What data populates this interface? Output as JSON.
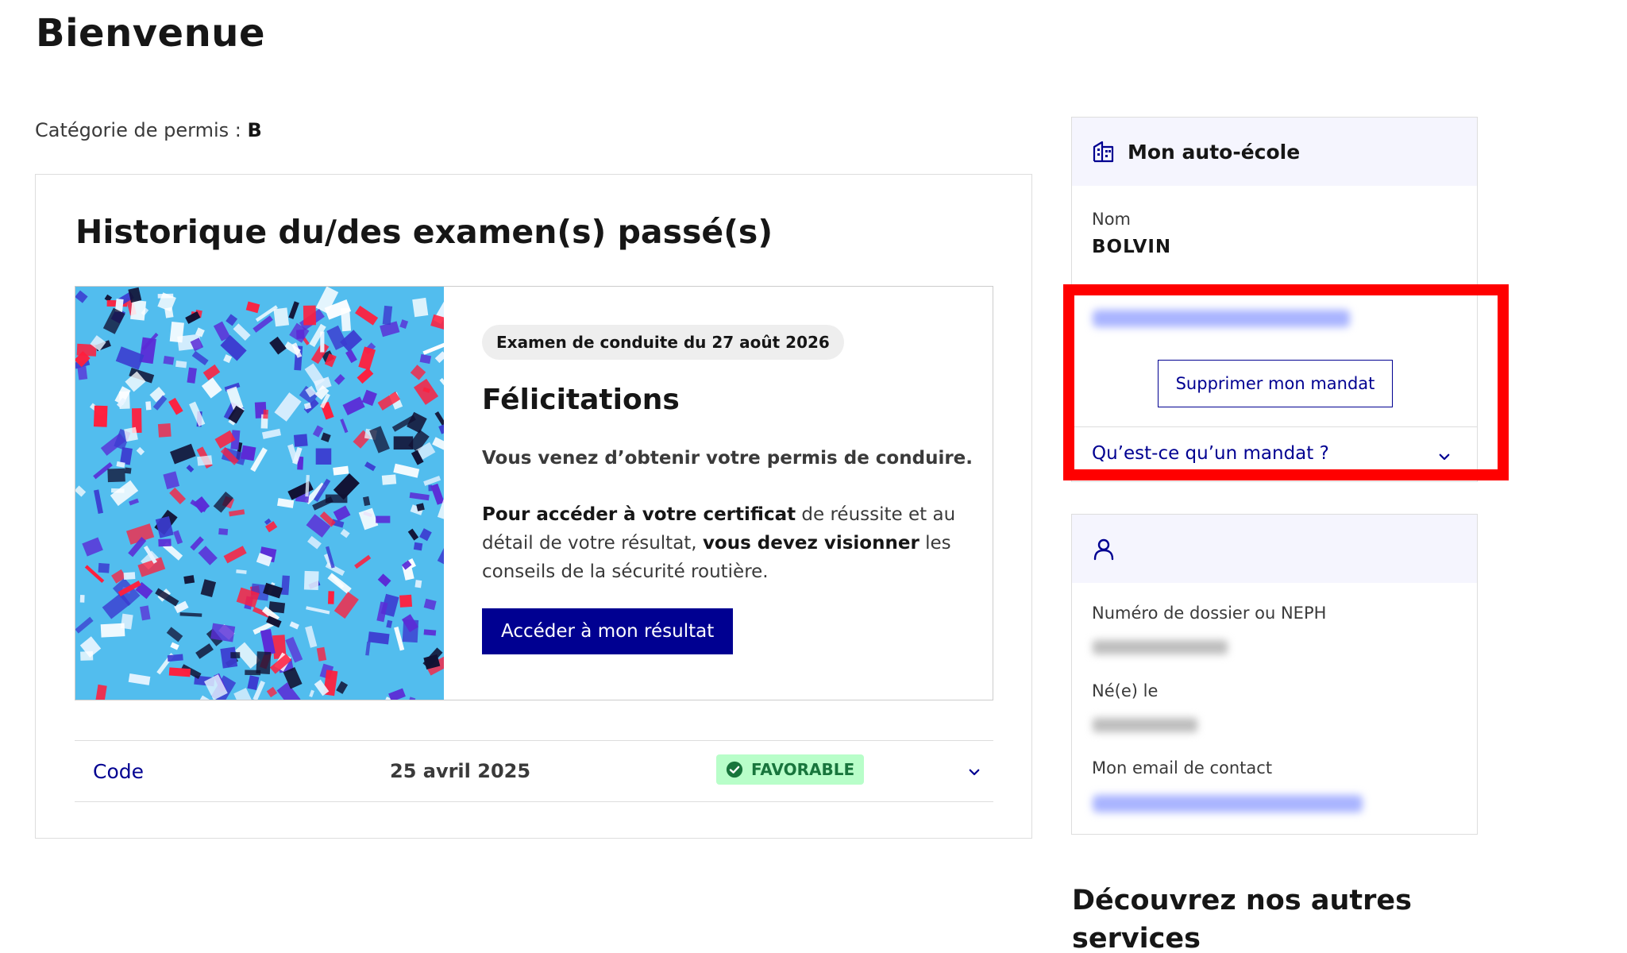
{
  "page": {
    "title": "Bienvenue",
    "permit_category_label": "Catégorie de permis : ",
    "permit_category_value": "B"
  },
  "history": {
    "title": "Historique du/des examen(s) passé(s)",
    "exam": {
      "badge": "Examen de conduite du 27 août 2026",
      "heading": "Félicitations",
      "text_line1": "Vous venez d’obtenir votre permis de conduire.",
      "text2_strong1": "Pour accéder à votre certificat",
      "text2_part1": " de réussite et au détail de votre résultat, ",
      "text2_strong2": "vous devez visionner",
      "text2_part2": " les conseils de la sécurité routière.",
      "button_label": "Accéder à mon résultat"
    },
    "code_row": {
      "label": "Code",
      "date": "25 avril 2025",
      "status": "FAVORABLE"
    }
  },
  "school_panel": {
    "title": "Mon auto-école",
    "name_label": "Nom",
    "name_value": "BOLVIN",
    "remove_mandate_label": "Supprimer mon mandat",
    "mandate_question": "Qu’est-ce qu’un mandat ?"
  },
  "user_panel": {
    "dossier_label": "Numéro de dossier ou NEPH",
    "birth_label": "Né(e) le",
    "email_label": "Mon email de contact"
  },
  "services": {
    "title": "Découvrez nos autres services"
  },
  "icons": {
    "school": "building-icon",
    "user": "user-icon",
    "check": "check-circle-icon",
    "chevron": "chevron-down-icon"
  },
  "colors": {
    "primary": "#000091",
    "highlight": "#ff0000",
    "success_bg": "#b8fec9",
    "success_text": "#18753c",
    "panel_header_bg": "#f5f5fe"
  }
}
